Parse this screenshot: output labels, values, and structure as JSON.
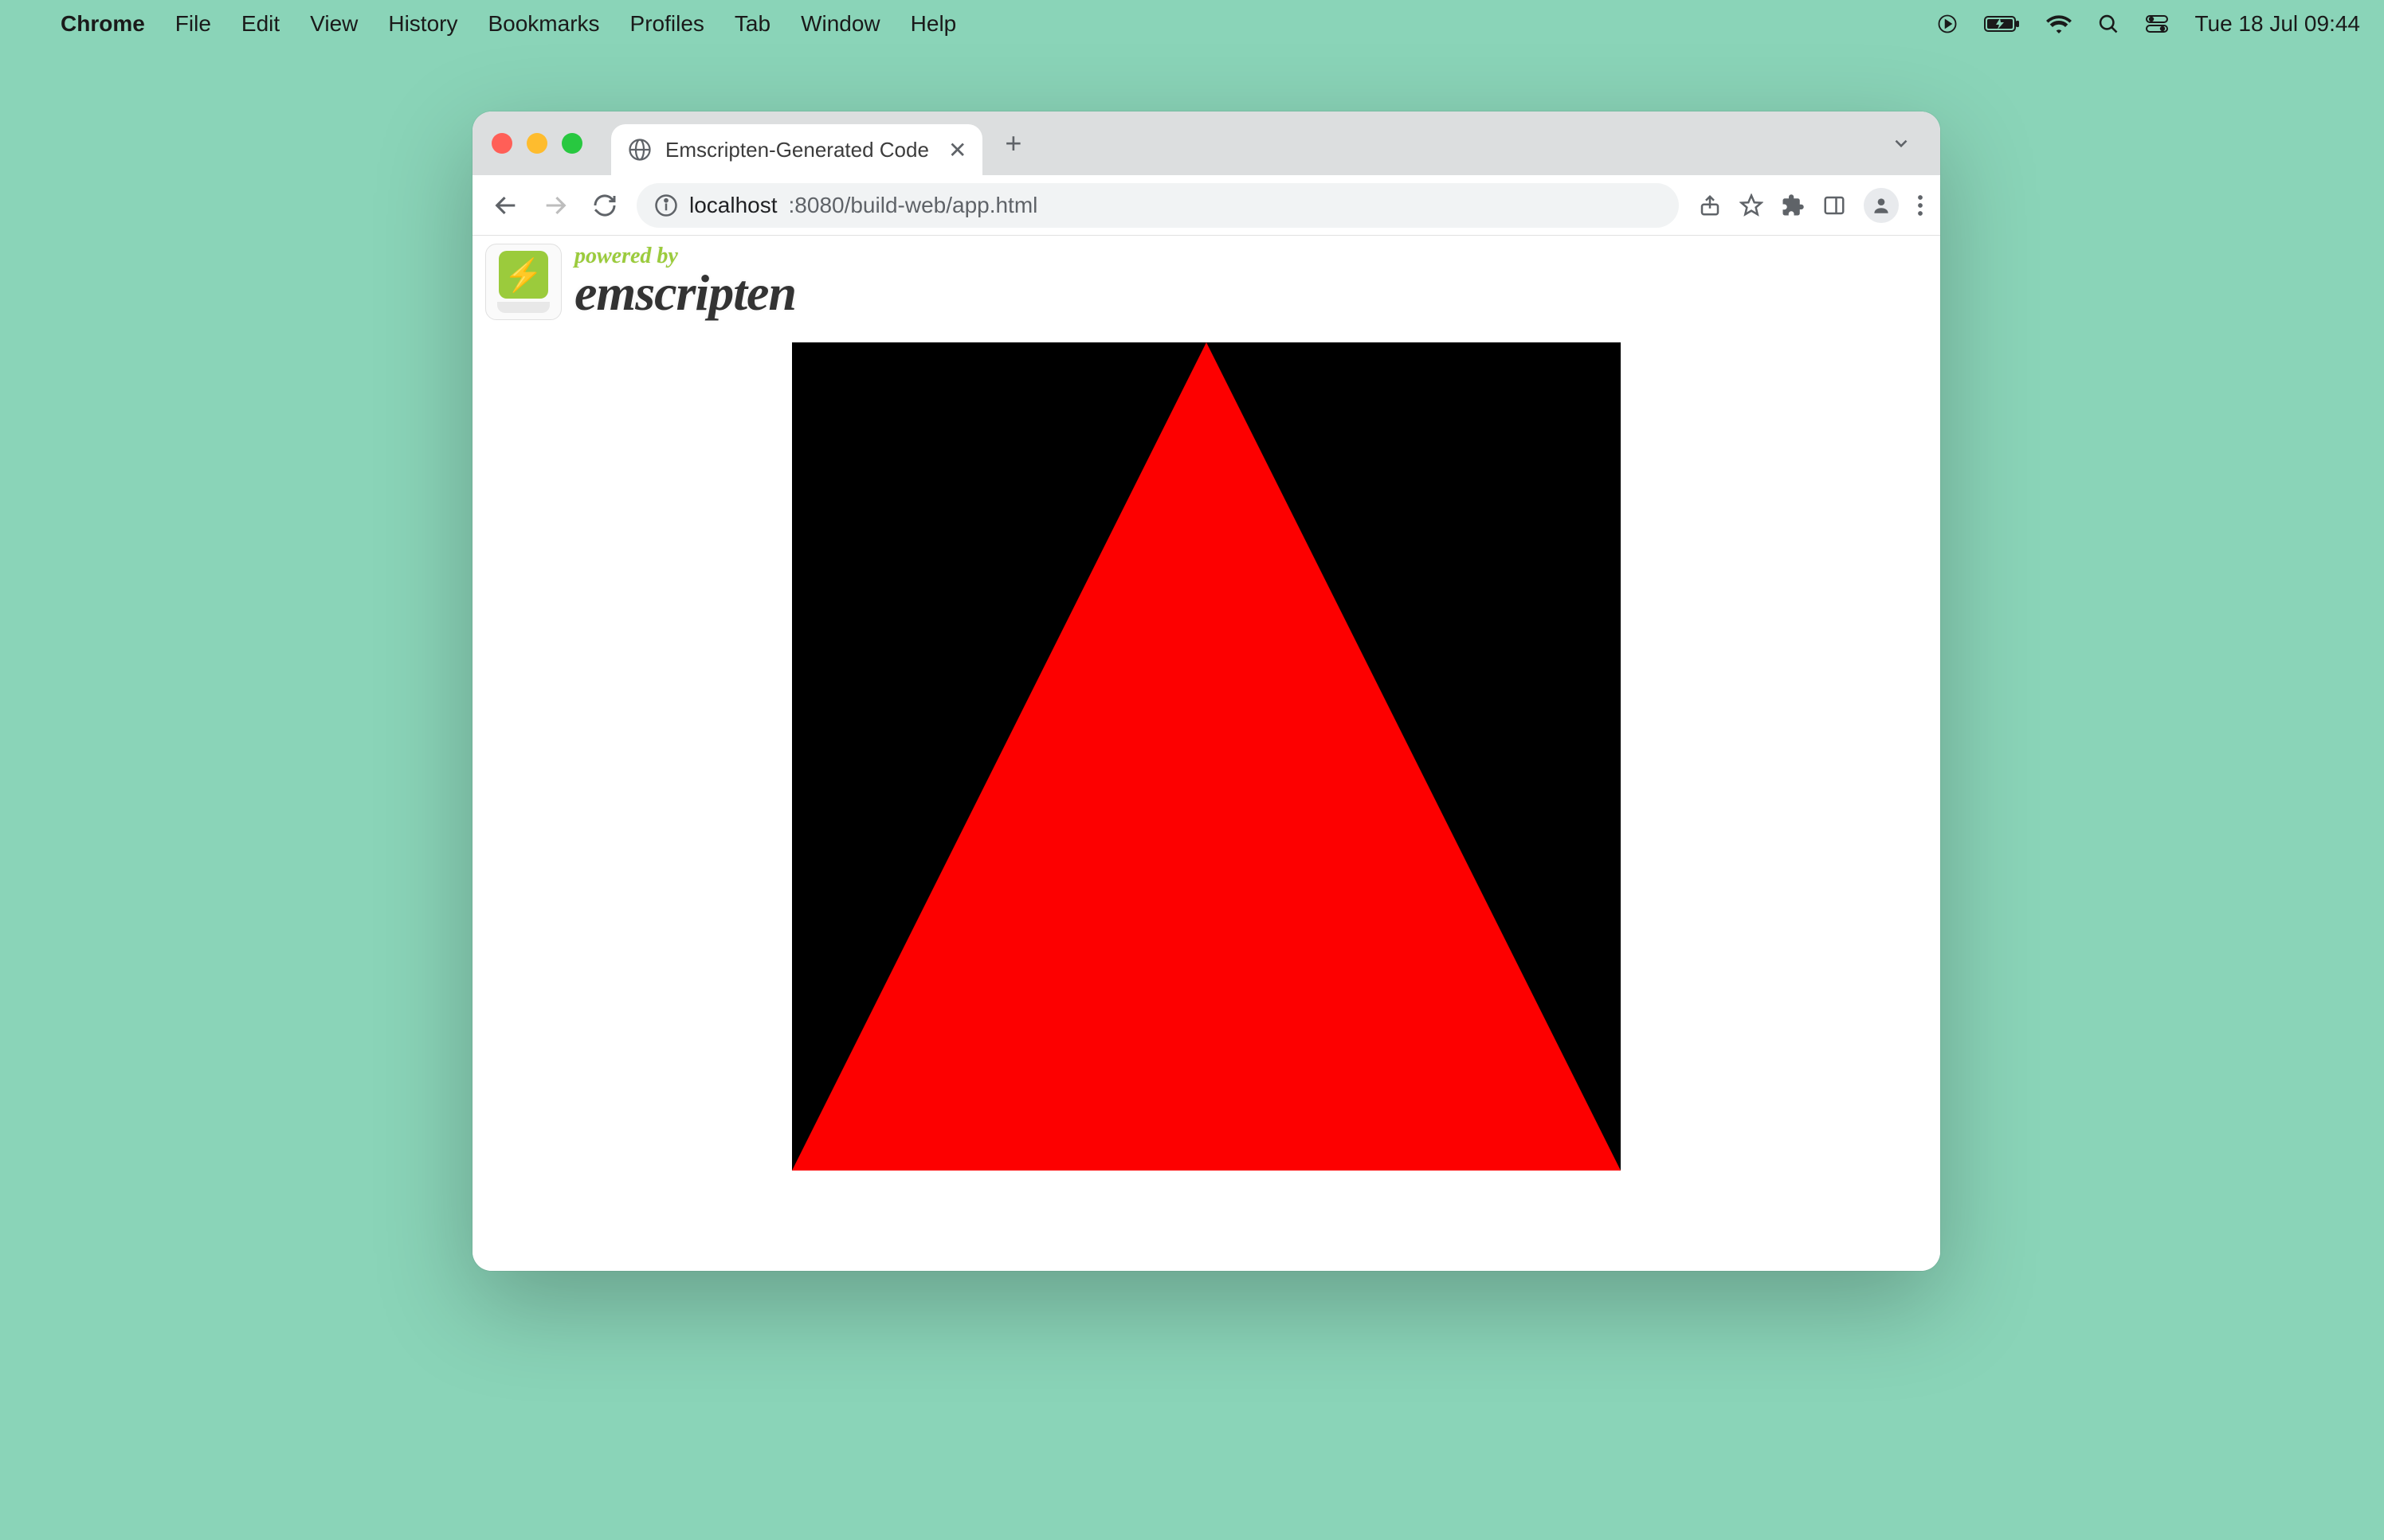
{
  "menubar": {
    "app_name": "Chrome",
    "items": [
      "File",
      "Edit",
      "View",
      "History",
      "Bookmarks",
      "Profiles",
      "Tab",
      "Window",
      "Help"
    ],
    "clock": "Tue 18 Jul  09:44"
  },
  "browser": {
    "tab": {
      "title": "Emscripten-Generated Code"
    },
    "url": {
      "host": "localhost",
      "rest": ":8080/build-web/app.html"
    }
  },
  "page": {
    "powered_by": "powered by",
    "brand": "emscripten"
  }
}
